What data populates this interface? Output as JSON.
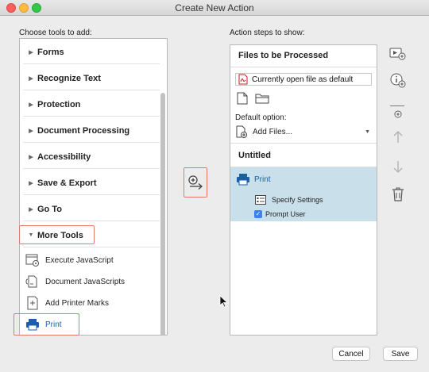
{
  "window": {
    "title": "Create New Action"
  },
  "left": {
    "label": "Choose tools to add:",
    "categories": [
      {
        "label": "Forms"
      },
      {
        "label": "Recognize Text"
      },
      {
        "label": "Protection"
      },
      {
        "label": "Document Processing"
      },
      {
        "label": "Accessibility"
      },
      {
        "label": "Save & Export"
      },
      {
        "label": "Go To"
      },
      {
        "label": "More Tools"
      }
    ],
    "items": [
      {
        "label": "Execute JavaScript",
        "icon": "javascript-icon"
      },
      {
        "label": "Document JavaScripts",
        "icon": "document-javascript-icon"
      },
      {
        "label": "Add Printer Marks",
        "icon": "printer-marks-icon"
      },
      {
        "label": "Print",
        "icon": "printer-icon"
      }
    ]
  },
  "right": {
    "label": "Action steps to show:",
    "files_header": "Files to be Processed",
    "file_value": "Currently open file as default",
    "default_option_label": "Default option:",
    "default_option_value": "Add Files...",
    "untitled": "Untitled",
    "step": {
      "label": "Print",
      "specify": "Specify Settings",
      "prompt": "Prompt User",
      "prompt_checked": true
    }
  },
  "buttons": {
    "cancel": "Cancel",
    "save": "Save"
  },
  "colors": {
    "highlight": "#e07a6a",
    "link": "#1b5fa8",
    "step_bg": "#c9dfea",
    "checkbox": "#3b82f0"
  }
}
